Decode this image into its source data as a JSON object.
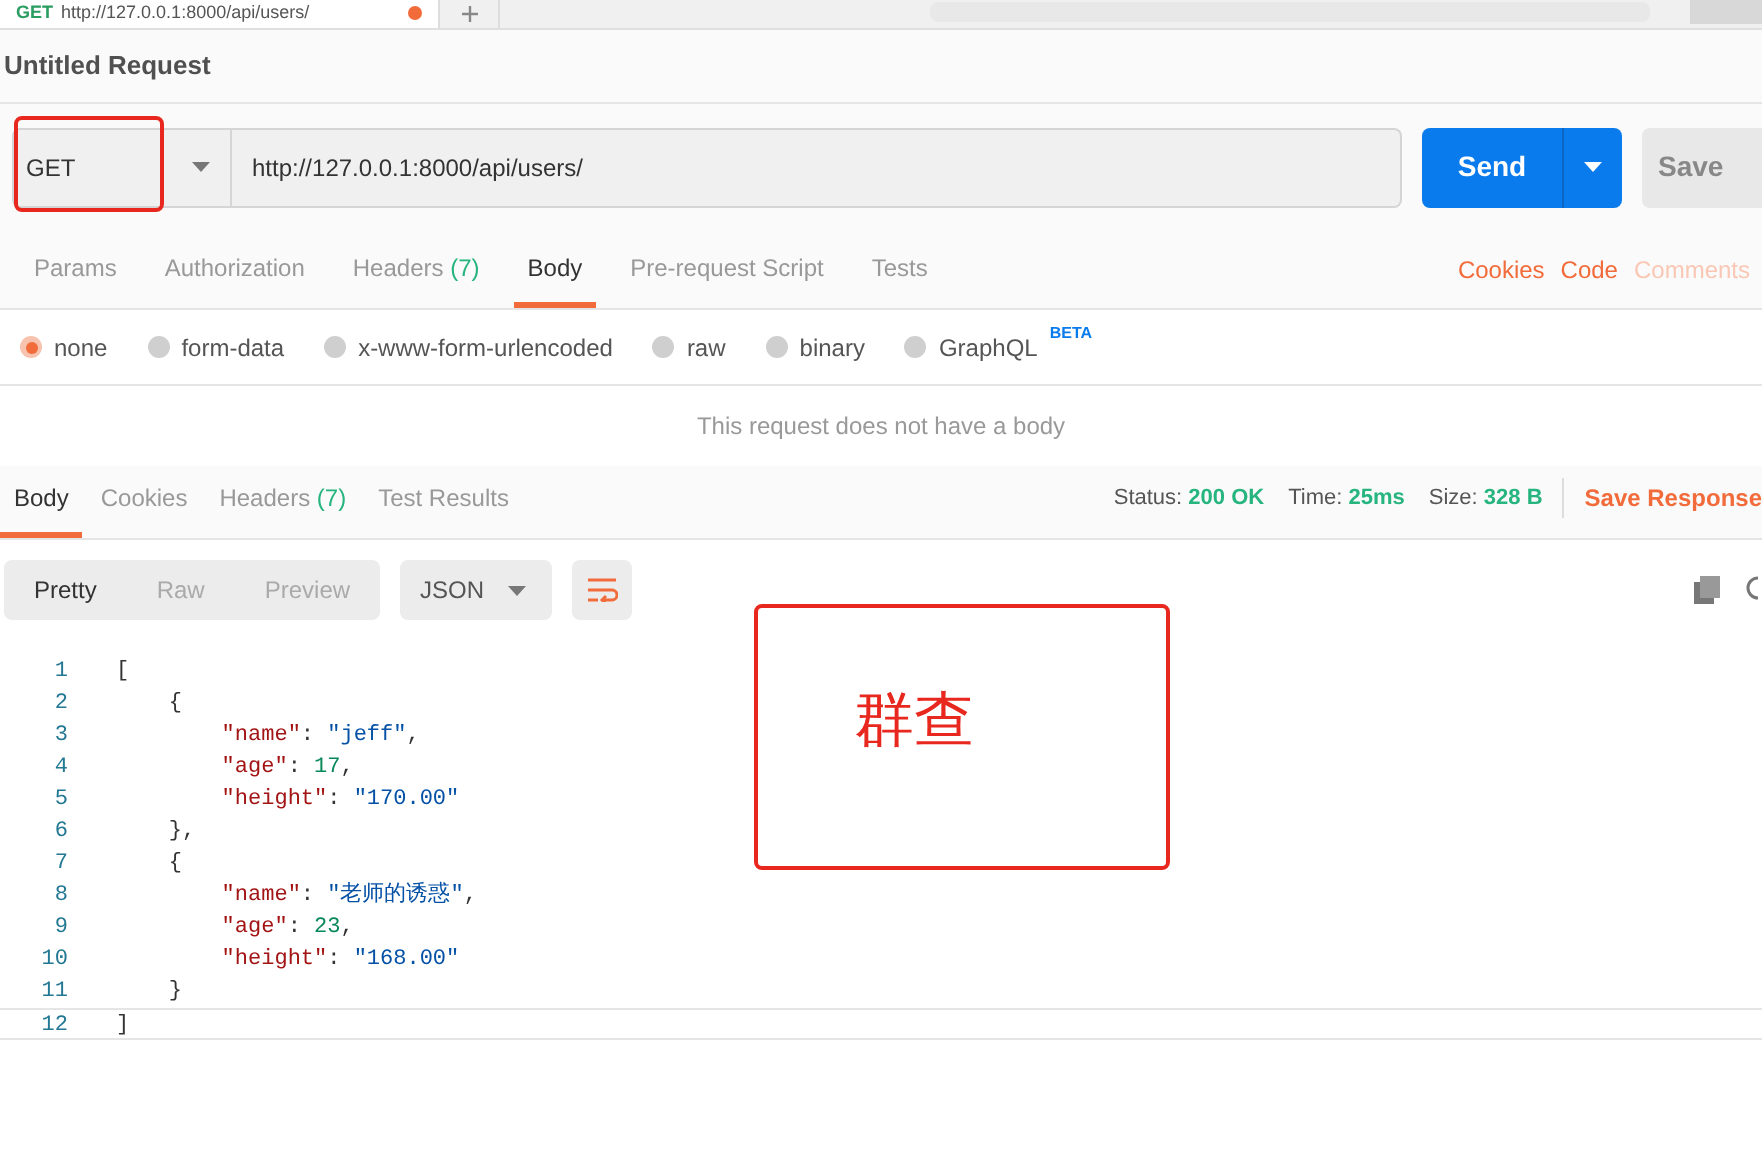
{
  "request_tab": {
    "method": "GET",
    "url": "http://127.0.0.1:8000/api/users/",
    "unsaved": true
  },
  "title": "Untitled Request",
  "request": {
    "method": "GET",
    "url": "http://127.0.0.1:8000/api/users/",
    "send": "Send",
    "save": "Save"
  },
  "request_tabs": [
    {
      "label": "Params",
      "selected": false
    },
    {
      "label": "Authorization",
      "selected": false
    },
    {
      "label": "Headers",
      "count": "(7)",
      "selected": false
    },
    {
      "label": "Body",
      "selected": true
    },
    {
      "label": "Pre-request Script",
      "selected": false
    },
    {
      "label": "Tests",
      "selected": false
    }
  ],
  "request_links": [
    {
      "label": "Cookies",
      "disabled": false
    },
    {
      "label": "Code",
      "disabled": false
    },
    {
      "label": "Comments",
      "disabled": true
    }
  ],
  "body_types": [
    {
      "label": "none",
      "selected": true
    },
    {
      "label": "form-data",
      "selected": false
    },
    {
      "label": "x-www-form-urlencoded",
      "selected": false
    },
    {
      "label": "raw",
      "selected": false
    },
    {
      "label": "binary",
      "selected": false
    },
    {
      "label": "GraphQL",
      "selected": false,
      "badge": "BETA"
    }
  ],
  "empty_body": "This request does not have a body",
  "response_tabs": [
    {
      "label": "Body",
      "selected": true
    },
    {
      "label": "Cookies",
      "selected": false
    },
    {
      "label": "Headers",
      "count": "(7)",
      "selected": false
    },
    {
      "label": "Test Results",
      "selected": false
    }
  ],
  "response_meta": [
    {
      "label": "Status:",
      "value": "200 OK"
    },
    {
      "label": "Time:",
      "value": "25ms"
    },
    {
      "label": "Size:",
      "value": "328 B"
    }
  ],
  "save_response": "Save Response",
  "view_modes": [
    {
      "label": "Pretty",
      "selected": true
    },
    {
      "label": "Raw",
      "selected": false
    },
    {
      "label": "Preview",
      "selected": false
    }
  ],
  "format": "JSON",
  "code_lines": [
    {
      "number": "1",
      "tokens": [
        {
          "kind": "punct",
          "text": "["
        }
      ]
    },
    {
      "number": "2",
      "tokens": [
        {
          "kind": "punct",
          "text": "    {"
        }
      ]
    },
    {
      "number": "3",
      "tokens": [
        {
          "kind": "key",
          "text": "        \"name\""
        },
        {
          "kind": "punct",
          "text": ": "
        },
        {
          "kind": "string",
          "text": "\"jeff\""
        },
        {
          "kind": "punct",
          "text": ","
        }
      ]
    },
    {
      "number": "4",
      "tokens": [
        {
          "kind": "key",
          "text": "        \"age\""
        },
        {
          "kind": "punct",
          "text": ": "
        },
        {
          "kind": "number",
          "text": "17"
        },
        {
          "kind": "punct",
          "text": ","
        }
      ]
    },
    {
      "number": "5",
      "tokens": [
        {
          "kind": "key",
          "text": "        \"height\""
        },
        {
          "kind": "punct",
          "text": ": "
        },
        {
          "kind": "string",
          "text": "\"170.00\""
        }
      ]
    },
    {
      "number": "6",
      "tokens": [
        {
          "kind": "punct",
          "text": "    },"
        }
      ]
    },
    {
      "number": "7",
      "tokens": [
        {
          "kind": "punct",
          "text": "    {"
        }
      ]
    },
    {
      "number": "8",
      "tokens": [
        {
          "kind": "key",
          "text": "        \"name\""
        },
        {
          "kind": "punct",
          "text": ": "
        },
        {
          "kind": "string",
          "text": "\"老师的诱惑\""
        },
        {
          "kind": "punct",
          "text": ","
        }
      ]
    },
    {
      "number": "9",
      "tokens": [
        {
          "kind": "key",
          "text": "        \"age\""
        },
        {
          "kind": "punct",
          "text": ": "
        },
        {
          "kind": "number",
          "text": "23"
        },
        {
          "kind": "punct",
          "text": ","
        }
      ]
    },
    {
      "number": "10",
      "tokens": [
        {
          "kind": "key",
          "text": "        \"height\""
        },
        {
          "kind": "punct",
          "text": ": "
        },
        {
          "kind": "string",
          "text": "\"168.00\""
        }
      ]
    },
    {
      "number": "11",
      "tokens": [
        {
          "kind": "punct",
          "text": "    }"
        }
      ]
    },
    {
      "number": "12",
      "tokens": [
        {
          "kind": "punct",
          "text": "]"
        }
      ]
    }
  ],
  "annotation": "群查"
}
